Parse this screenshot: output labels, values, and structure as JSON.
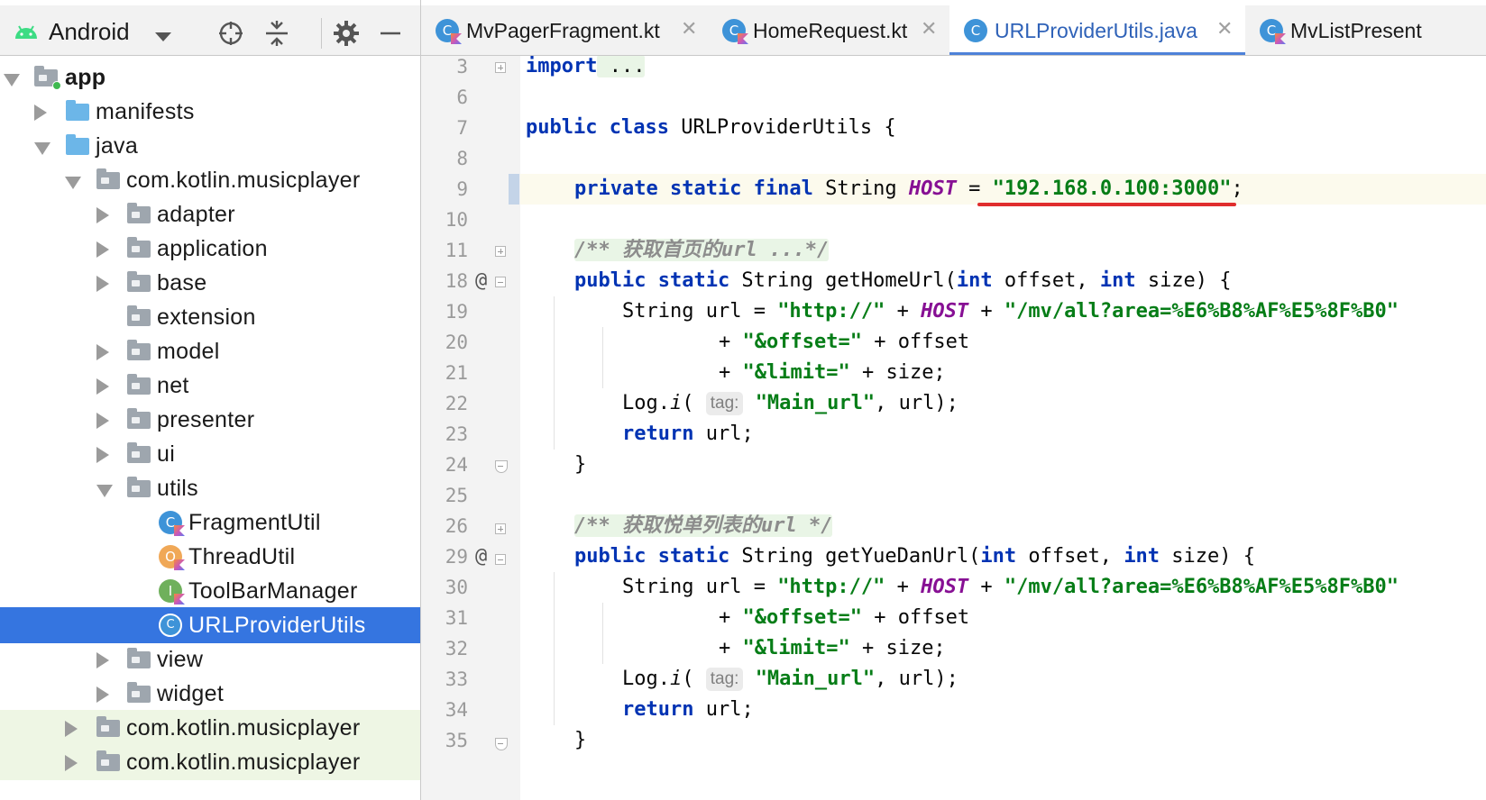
{
  "project_pane": {
    "view_label": "Android",
    "tree": [
      {
        "label": "app",
        "bold": true
      },
      {
        "label": "manifests"
      },
      {
        "label": "java"
      },
      {
        "label": "com.kotlin.musicplayer"
      },
      {
        "label": "adapter"
      },
      {
        "label": "application"
      },
      {
        "label": "base"
      },
      {
        "label": "extension"
      },
      {
        "label": "model"
      },
      {
        "label": "net"
      },
      {
        "label": "presenter"
      },
      {
        "label": "ui"
      },
      {
        "label": "utils"
      },
      {
        "label": "FragmentUtil"
      },
      {
        "label": "ThreadUtil"
      },
      {
        "label": "ToolBarManager"
      },
      {
        "label": "URLProviderUtils",
        "selected": true
      },
      {
        "label": "view"
      },
      {
        "label": "widget"
      },
      {
        "label": "com.kotlin.musicplayer"
      },
      {
        "label": "com.kotlin.musicplayer"
      }
    ]
  },
  "tabs": [
    {
      "label": "MvPagerFragment.kt"
    },
    {
      "label": "HomeRequest.kt"
    },
    {
      "label": "URLProviderUtils.java",
      "active": true
    },
    {
      "label": "MvListPresent"
    }
  ],
  "editor": {
    "line_numbers": [
      "3",
      "6",
      "7",
      "8",
      "9",
      "10",
      "11",
      "18",
      "19",
      "20",
      "21",
      "22",
      "23",
      "24",
      "25",
      "26",
      "29",
      "30",
      "31",
      "32",
      "33",
      "34",
      "35"
    ],
    "code": {
      "l3_kw": "import",
      "l3_rest": " ...",
      "l7_kw": "public class",
      "l7_rest": " URLProviderUtils {",
      "l9_kw": "private static final",
      "l9_type": " String ",
      "l9_const": "HOST",
      "l9_eq": " = ",
      "l9_str": "\"192.168.0.100:3000\"",
      "l9_end": ";",
      "l11_cmt": "/** 获取首页的url ...*/",
      "l18_kw": "public static",
      "l18_mid": " String getHomeUrl(",
      "l18_int1": "int",
      "l18_mid2": " offset, ",
      "l18_int2": "int",
      "l18_end": " size) {",
      "l19_a": "String url = ",
      "l19_s1": "\"http://\"",
      "l19_b": " + ",
      "l19_const": "HOST",
      "l19_c": " + ",
      "l19_s2": "\"/mv/all?area=%E6%B8%AF%E5%8F%B0\"",
      "l20_a": "+ ",
      "l20_s": "\"&offset=\"",
      "l20_b": " + offset",
      "l21_a": "+ ",
      "l21_s": "\"&limit=\"",
      "l21_b": " + size;",
      "l22_a": "Log.",
      "l22_i": "i",
      "l22_b": "( ",
      "l22_hint": "tag:",
      "l22_s": "\"Main_url\"",
      "l22_c": ", url);",
      "l23_kw": "return",
      "l23_rest": " url;",
      "l24": "}",
      "l26_cmt": "/** 获取悦单列表的url */",
      "l29_kw": "public static",
      "l29_mid": " String getYueDanUrl(",
      "l29_int1": "int",
      "l29_mid2": " offset, ",
      "l29_int2": "int",
      "l29_end": " size) {",
      "l30_a": "String url = ",
      "l30_s1": "\"http://\"",
      "l30_b": " + ",
      "l30_const": "HOST",
      "l30_c": " + ",
      "l30_s2": "\"/mv/all?area=%E6%B8%AF%E5%8F%B0\"",
      "l31_a": "+ ",
      "l31_s": "\"&offset=\"",
      "l31_b": " + offset",
      "l32_a": "+ ",
      "l32_s": "\"&limit=\"",
      "l32_b": " + size;",
      "l33_a": "Log.",
      "l33_i": "i",
      "l33_b": "( ",
      "l33_hint": "tag:",
      "l33_s": "\"Main_url\"",
      "l33_c": ", url);",
      "l34_kw": "return",
      "l34_rest": " url;",
      "l35": "}"
    },
    "gutter_marks": {
      "override": "@"
    }
  },
  "colors": {
    "selection": "#3575e0",
    "keyword": "#0033b3",
    "string": "#067d17",
    "constant": "#871094",
    "comment": "#8c8c8c",
    "annotation_underline": "#e02d2d"
  },
  "icons": {
    "view_icon": "android-icon",
    "header_buttons": [
      "locate-icon",
      "collapse-all-icon",
      "gear-icon",
      "minimize-icon"
    ],
    "class_icon": "kotlin-class-icon"
  }
}
